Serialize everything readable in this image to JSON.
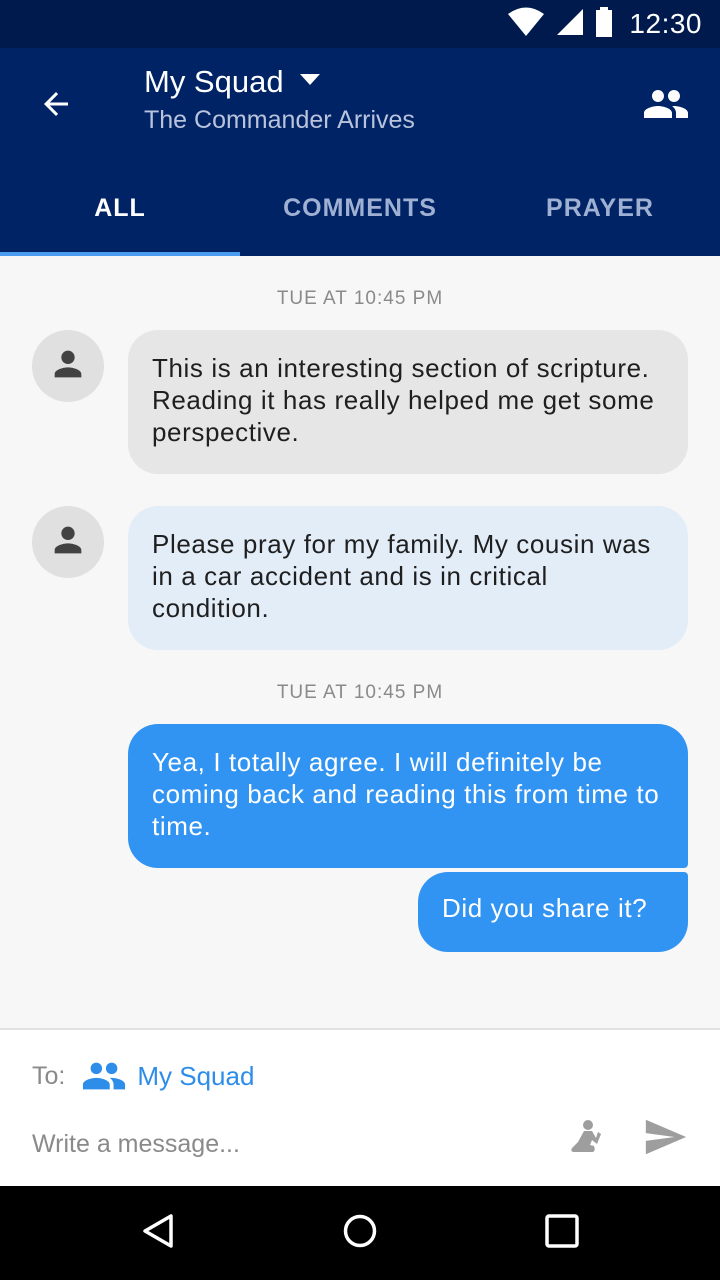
{
  "status_bar": {
    "time": "12:30"
  },
  "header": {
    "title": "My Squad",
    "subtitle": "The Commander Arrives"
  },
  "tabs": [
    {
      "label": "ALL",
      "active": true
    },
    {
      "label": "COMMENTS",
      "active": false
    },
    {
      "label": "PRAYER",
      "active": false
    }
  ],
  "timestamps": [
    "TUE AT 10:45 PM",
    "TUE AT 10:45 PM"
  ],
  "messages": [
    {
      "direction": "incoming",
      "text": "This is an interesting section of scripture. Reading it has really helped me get some perspective."
    },
    {
      "direction": "incoming",
      "text": "Please pray for my family. My cousin was in a car accident and is in critical condition."
    },
    {
      "direction": "outgoing",
      "text": "Yea, I totally agree. I will definitely be coming back and reading this from time to time."
    },
    {
      "direction": "outgoing",
      "text": "Did you share it?"
    }
  ],
  "composer": {
    "to_label": "To:",
    "to_value": "My Squad",
    "placeholder": "Write a message..."
  },
  "colors": {
    "app_bar": "#002366",
    "status_bar": "#001a4d",
    "accent": "#3294f2",
    "incoming_gray": "#e6e6e6",
    "incoming_blue": "#e3edf8"
  },
  "icons": [
    "wifi-icon",
    "signal-icon",
    "battery-icon",
    "back-arrow-icon",
    "dropdown-caret-icon",
    "group-icon",
    "person-icon",
    "praying-icon",
    "send-icon",
    "nav-back-icon",
    "nav-home-icon",
    "nav-recents-icon"
  ]
}
